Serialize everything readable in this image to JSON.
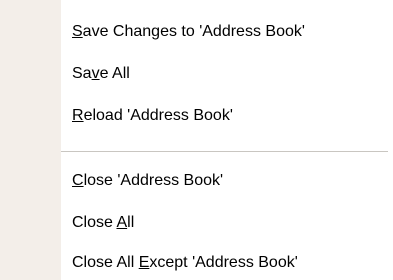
{
  "menu": {
    "items": [
      {
        "pre": "",
        "mn": "S",
        "post": "ave Changes to 'Address Book'"
      },
      {
        "pre": "Sa",
        "mn": "v",
        "post": "e All"
      },
      {
        "pre": "",
        "mn": "R",
        "post": "eload 'Address Book'"
      },
      {
        "pre": "",
        "mn": "C",
        "post": "lose 'Address Book'"
      },
      {
        "pre": "Close ",
        "mn": "A",
        "post": "ll"
      },
      {
        "pre": "Close All ",
        "mn": "E",
        "post": "xcept 'Address Book'"
      }
    ]
  },
  "colors": {
    "gutter": "#f3eee9",
    "separator": "#c9c6c1",
    "background": "#ffffff",
    "text": "#000000"
  }
}
